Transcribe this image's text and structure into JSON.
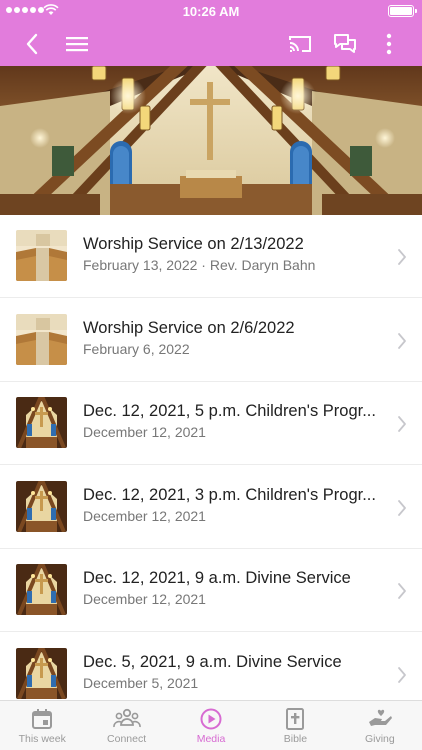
{
  "status_bar": {
    "time": "10:26 AM"
  },
  "colors": {
    "accent": "#e27cdc",
    "tab_active": "#d76bd2",
    "tab_inactive": "#9a9a9a"
  },
  "nav": {
    "icons": [
      "back-icon",
      "menu-icon",
      "cast-icon",
      "chat-icon",
      "more-icon"
    ]
  },
  "media_list": [
    {
      "title": "Worship Service on 2/13/2022",
      "subtitle": "February 13, 2022 · Rev. Daryn Bahn",
      "thumb": "pews"
    },
    {
      "title": "Worship Service on 2/6/2022",
      "subtitle": "February 6, 2022",
      "thumb": "pews"
    },
    {
      "title": "Dec. 12, 2021, 5 p.m. Children's Progr...",
      "subtitle": "December 12, 2021",
      "thumb": "altar"
    },
    {
      "title": "Dec. 12, 2021, 3 p.m. Children's Progr...",
      "subtitle": "December 12, 2021",
      "thumb": "altar"
    },
    {
      "title": "Dec. 12, 2021, 9 a.m. Divine Service",
      "subtitle": "December 12, 2021",
      "thumb": "altar"
    },
    {
      "title": "Dec. 5, 2021, 9 a.m. Divine Service",
      "subtitle": "December 5, 2021",
      "thumb": "altar"
    }
  ],
  "tabs": [
    {
      "label": "This week",
      "icon": "calendar-icon",
      "active": false
    },
    {
      "label": "Connect",
      "icon": "people-icon",
      "active": false
    },
    {
      "label": "Media",
      "icon": "play-icon",
      "active": true
    },
    {
      "label": "Bible",
      "icon": "bible-icon",
      "active": false
    },
    {
      "label": "Giving",
      "icon": "giving-hand-icon",
      "active": false
    }
  ]
}
